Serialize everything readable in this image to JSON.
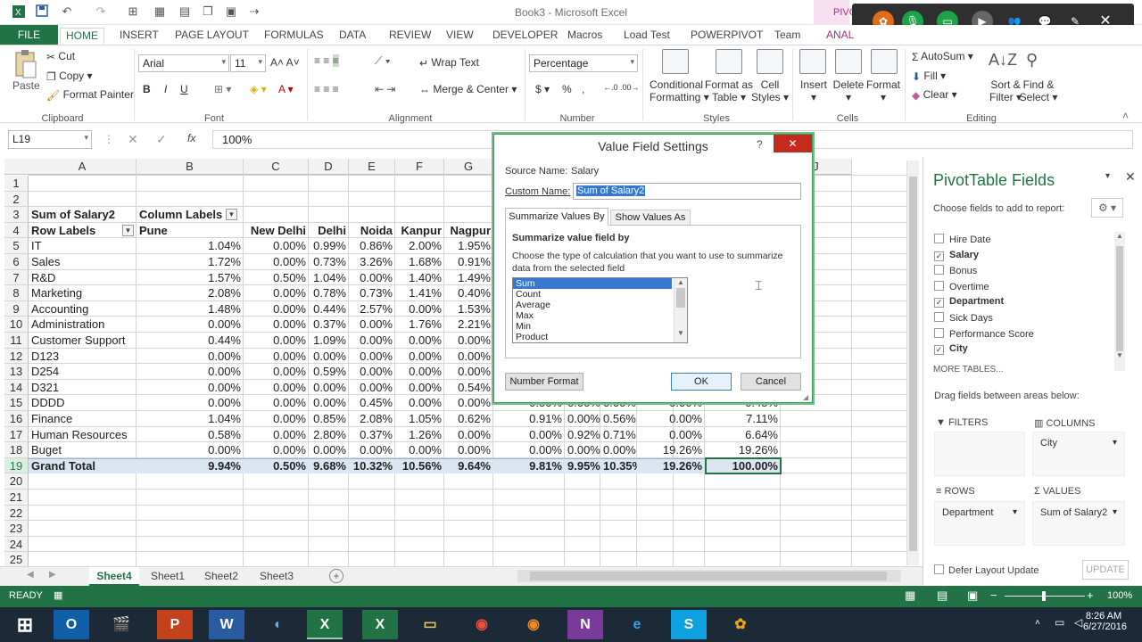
{
  "window": {
    "title": "Book3 - Microsoft Excel"
  },
  "ribbon": {
    "tabs": [
      "FILE",
      "HOME",
      "INSERT",
      "PAGE LAYOUT",
      "FORMULAS",
      "DATA",
      "REVIEW",
      "VIEW",
      "DEVELOPER",
      "Macros",
      "Load Test",
      "POWERPIVOT",
      "Team",
      "ANAL"
    ],
    "ctx_tab": "PIVO",
    "clipboard": {
      "paste": "Paste",
      "cut": "Cut",
      "copy": "Copy",
      "painter": "Format Painter",
      "label": "Clipboard"
    },
    "font": {
      "name": "Arial",
      "size": "11",
      "label": "Font",
      "bold": "B",
      "italic": "I",
      "underline": "U"
    },
    "alignment": {
      "wrap": "Wrap Text",
      "merge": "Merge & Center",
      "label": "Alignment"
    },
    "number": {
      "format": "Percentage",
      "label": "Number",
      "currency": "$",
      "percent": "%",
      "comma": ","
    },
    "styles": {
      "cond": "Conditional",
      "cond2": "Formatting",
      "fmt": "Format as",
      "fmt2": "Table",
      "cell": "Cell",
      "cell2": "Styles",
      "label": "Styles"
    },
    "cells": {
      "insert": "Insert",
      "delete": "Delete",
      "format": "Format",
      "label": "Cells"
    },
    "editing": {
      "autosum": "AutoSum",
      "fill": "Fill",
      "clear": "Clear",
      "sort": "Sort &",
      "sort2": "Filter",
      "find": "Find &",
      "find2": "Select",
      "label": "Editing"
    }
  },
  "formula_bar": {
    "name_box": "L19",
    "fx": "fx",
    "value": "100%"
  },
  "grid": {
    "columns": [
      "A",
      "B",
      "C",
      "D",
      "E",
      "F",
      "G",
      "",
      "",
      "",
      "",
      "",
      "I",
      "J"
    ],
    "row_numbers": [
      "1",
      "2",
      "3",
      "4",
      "5",
      "6",
      "7",
      "8",
      "9",
      "10",
      "11",
      "12",
      "13",
      "14",
      "15",
      "16",
      "17",
      "18",
      "19",
      "20",
      "21",
      "22",
      "23",
      "24",
      "25"
    ],
    "pivot_header": {
      "a3": "Sum of Salary2",
      "b3": "Column Labels",
      "a4": "Row Labels",
      "b4": "Pune",
      "c4": "New Delhi",
      "d4": "Delhi",
      "e4": "Noida",
      "f4": "Kanpur",
      "g4": "Nagpur"
    },
    "rows": [
      {
        "label": "IT",
        "v": [
          "1.04%",
          "0.00%",
          "0.99%",
          "0.86%",
          "2.00%",
          "1.95%"
        ]
      },
      {
        "label": "Sales",
        "v": [
          "1.72%",
          "0.00%",
          "0.73%",
          "3.26%",
          "1.68%",
          "0.91%"
        ]
      },
      {
        "label": "R&D",
        "v": [
          "1.57%",
          "0.50%",
          "1.04%",
          "0.00%",
          "1.40%",
          "1.49%"
        ]
      },
      {
        "label": "Marketing",
        "v": [
          "2.08%",
          "0.00%",
          "0.78%",
          "0.73%",
          "1.41%",
          "0.40%"
        ]
      },
      {
        "label": "Accounting",
        "v": [
          "1.48%",
          "0.00%",
          "0.44%",
          "2.57%",
          "0.00%",
          "1.53%"
        ]
      },
      {
        "label": "Administration",
        "v": [
          "0.00%",
          "0.00%",
          "0.37%",
          "0.00%",
          "1.76%",
          "2.21%"
        ]
      },
      {
        "label": "Customer Support",
        "v": [
          "0.44%",
          "0.00%",
          "1.09%",
          "0.00%",
          "0.00%",
          "0.00%"
        ]
      },
      {
        "label": "D123",
        "v": [
          "0.00%",
          "0.00%",
          "0.00%",
          "0.00%",
          "0.00%",
          "0.00%"
        ]
      },
      {
        "label": "D254",
        "v": [
          "0.00%",
          "0.00%",
          "0.59%",
          "0.00%",
          "0.00%",
          "0.00%"
        ]
      },
      {
        "label": "D321",
        "v": [
          "0.00%",
          "0.00%",
          "0.00%",
          "0.00%",
          "0.00%",
          "0.54%"
        ]
      },
      {
        "label": "DDDD",
        "v": [
          "0.00%",
          "0.00%",
          "0.00%",
          "0.45%",
          "0.00%",
          "0.00%"
        ],
        "ext": [
          "0.00%",
          "0.00%",
          "0.00%",
          "0.00%",
          "0.45%"
        ]
      },
      {
        "label": "Finance",
        "v": [
          "1.04%",
          "0.00%",
          "0.85%",
          "2.08%",
          "1.05%",
          "0.62%"
        ],
        "ext": [
          "0.91%",
          "0.00%",
          "0.56%",
          "0.00%",
          "7.11%"
        ]
      },
      {
        "label": "Human Resources",
        "v": [
          "0.58%",
          "0.00%",
          "2.80%",
          "0.37%",
          "1.26%",
          "0.00%"
        ],
        "ext": [
          "0.00%",
          "0.92%",
          "0.71%",
          "0.00%",
          "6.64%"
        ]
      },
      {
        "label": "Buget",
        "v": [
          "0.00%",
          "0.00%",
          "0.00%",
          "0.00%",
          "0.00%",
          "0.00%"
        ],
        "ext": [
          "0.00%",
          "0.00%",
          "0.00%",
          "19.26%",
          "19.26%"
        ]
      }
    ],
    "grand": {
      "label": "Grand Total",
      "v": [
        "9.94%",
        "0.50%",
        "9.68%",
        "10.32%",
        "10.56%",
        "9.64%"
      ],
      "ext": [
        "9.81%",
        "9.95%",
        "10.35%",
        "19.26%",
        "100.00%"
      ]
    }
  },
  "dialog": {
    "title": "Value Field Settings",
    "help": "?",
    "source_label": "Source Name:",
    "source_value": "Salary",
    "custom_label": "Custom Name:",
    "custom_value": "Sum of Salary2",
    "tab1": "Summarize Values By",
    "tab2": "Show Values As",
    "section": "Summarize value field by",
    "desc": "Choose the type of calculation that you want to use to summarize data from the selected field",
    "options": [
      "Sum",
      "Count",
      "Average",
      "Max",
      "Min",
      "Product"
    ],
    "number_format": "Number Format",
    "ok": "OK",
    "cancel": "Cancel"
  },
  "pivot_pane": {
    "title": "PivotTable Fields",
    "subtitle": "Choose fields to add to report:",
    "fields": [
      {
        "name": "Hire Date",
        "checked": false
      },
      {
        "name": "Salary",
        "checked": true
      },
      {
        "name": "Bonus",
        "checked": false
      },
      {
        "name": "Overtime",
        "checked": false
      },
      {
        "name": "Department",
        "checked": true
      },
      {
        "name": "Sick Days",
        "checked": false
      },
      {
        "name": "Performance Score",
        "checked": false
      },
      {
        "name": "City",
        "checked": true
      }
    ],
    "more": "MORE TABLES...",
    "drag": "Drag fields between areas below:",
    "filters": "FILTERS",
    "columns": "COLUMNS",
    "rows": "ROWS",
    "values": "VALUES",
    "col_item": "City",
    "row_item": "Department",
    "val_item": "Sum of Salary2",
    "defer": "Defer Layout Update",
    "update": "UPDATE"
  },
  "sheets": [
    "Sheet4",
    "Sheet1",
    "Sheet2",
    "Sheet3"
  ],
  "status": {
    "ready": "READY",
    "zoom": "100%"
  },
  "taskbar": {
    "time": "8:26 AM",
    "date": "6/27/2016"
  }
}
